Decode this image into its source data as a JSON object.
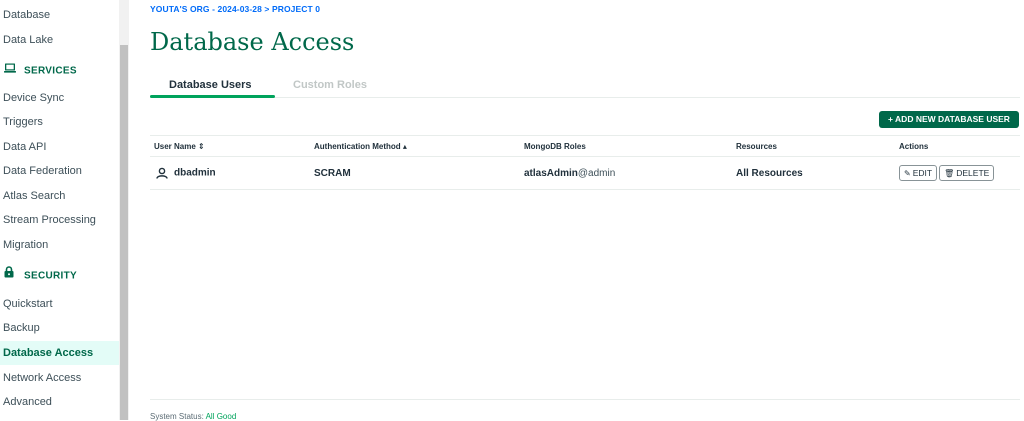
{
  "sidebar": {
    "items_top": [
      "Database",
      "Data Lake"
    ],
    "services_label": "SERVICES",
    "services_items": [
      "Device Sync",
      "Triggers",
      "Data API",
      "Data Federation",
      "Atlas Search",
      "Stream Processing",
      "Migration"
    ],
    "security_label": "SECURITY",
    "security_items": [
      "Quickstart",
      "Backup",
      "Database Access",
      "Network Access",
      "Advanced"
    ],
    "active_item": "Database Access"
  },
  "breadcrumb": "YOUTA'S ORG - 2024-03-28 > PROJECT 0",
  "page_title": "Database Access",
  "tabs": [
    "Database Users",
    "Custom Roles"
  ],
  "add_button_label": "+ ADD NEW DATABASE USER",
  "table": {
    "headers": [
      "User Name ⇕",
      "Authentication Method ▴",
      "MongoDB Roles",
      "Resources",
      "Actions"
    ],
    "rows": [
      {
        "user": "dbadmin",
        "auth": "SCRAM",
        "role": "atlasAdmin",
        "role_suffix": "@admin",
        "resources": "All Resources"
      }
    ],
    "edit_label": "EDIT",
    "delete_label": "DELETE"
  },
  "status": {
    "label": "System Status:",
    "value": "All Good"
  },
  "colors": {
    "brand": "#00684a",
    "accent": "#00a35c",
    "link": "#016bf8",
    "active_bg": "#e3fcf7"
  },
  "icons": {
    "services": "laptop-icon",
    "security": "lock-icon",
    "user": "user-icon",
    "edit": "pencil-icon",
    "delete": "trash-icon"
  }
}
